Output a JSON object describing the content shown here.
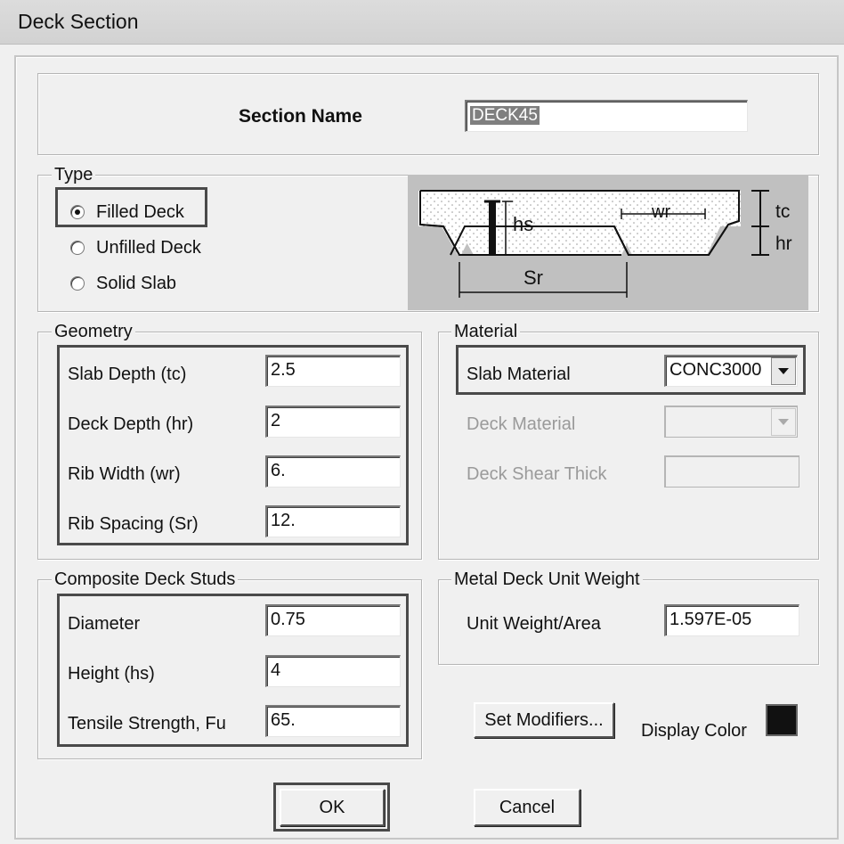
{
  "window": {
    "title": "Deck Section"
  },
  "section_name": {
    "label": "Section Name",
    "value": "DECK45"
  },
  "type": {
    "legend": "Type",
    "options": [
      {
        "label": "Filled Deck",
        "checked": true
      },
      {
        "label": "Unfilled Deck",
        "checked": false
      },
      {
        "label": "Solid Slab",
        "checked": false
      }
    ]
  },
  "diagram": {
    "tc": "tc",
    "hr": "hr",
    "hs": "hs",
    "wr": "wr",
    "sr": "Sr"
  },
  "geometry": {
    "legend": "Geometry",
    "rows": [
      {
        "label": "Slab Depth (tc)",
        "value": "2.5"
      },
      {
        "label": "Deck Depth (hr)",
        "value": "2"
      },
      {
        "label": "Rib Width (wr)",
        "value": "6."
      },
      {
        "label": "Rib Spacing (Sr)",
        "value": "12."
      }
    ]
  },
  "material": {
    "legend": "Material",
    "slab_material": {
      "label": "Slab Material",
      "value": "CONC3000"
    },
    "deck_material": {
      "label": "Deck Material",
      "value": ""
    },
    "deck_shear_thick": {
      "label": "Deck Shear Thick",
      "value": ""
    }
  },
  "studs": {
    "legend": "Composite Deck Studs",
    "rows": [
      {
        "label": "Diameter",
        "value": "0.75"
      },
      {
        "label": "Height (hs)",
        "value": "4"
      },
      {
        "label": "Tensile Strength, Fu",
        "value": "65."
      }
    ]
  },
  "unit_weight": {
    "legend": "Metal Deck Unit Weight",
    "label": "Unit Weight/Area",
    "value": "1.597E-05"
  },
  "buttons": {
    "set_modifiers": "Set Modifiers...",
    "ok": "OK",
    "cancel": "Cancel"
  },
  "display_color": {
    "label": "Display Color",
    "color": "#111111"
  }
}
